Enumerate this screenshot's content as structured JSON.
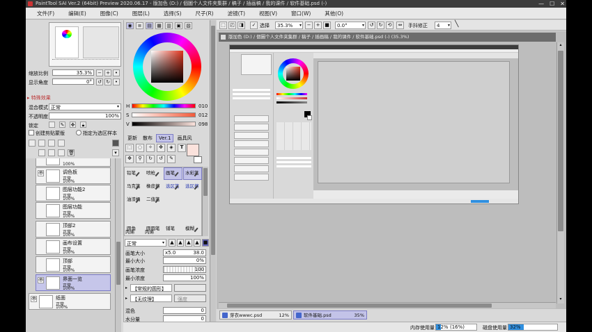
{
  "window": {
    "title": "PaintTool SAI Ver.2 (64bit) Preview 2020.06.17 - 版加色 (D:) / 個圖个人文件夹集群 / 稿子 / 插画稿 / 我的课件 / 软件基础.psd (-)",
    "buttons": [
      "—",
      "☐",
      "✕"
    ]
  },
  "menu": [
    "文件(F)",
    "编辑(E)",
    "图像(C)",
    "图层(L)",
    "选择(S)",
    "尺子(R)",
    "滤镜(T)",
    "视图(V)",
    "窗口(W)",
    "其他(O)"
  ],
  "navigator": {
    "zoom_label": "缩放比例",
    "zoom_value": "35.3%",
    "angle_label": "显示角度",
    "angle_value": "0°"
  },
  "layer_props": {
    "effects_header": "▸ 特殊效果",
    "blend_label": "混合模式",
    "blend_value": "正常",
    "opacity_label": "不透明度",
    "opacity_value": "100%",
    "lock_label": "锁定",
    "clip_label": "创建剪贴蒙版",
    "select_src_label": "指定为选区样本"
  },
  "layers": [
    {
      "name": "",
      "mode": "",
      "opacity": "100%"
    },
    {
      "name": "调色板",
      "mode": "正常",
      "opacity": "100%"
    },
    {
      "name": "图层功能2",
      "mode": "正常",
      "opacity": "100%"
    },
    {
      "name": "图层功能",
      "mode": "正常",
      "opacity": "100%"
    },
    {
      "name": "顶部2",
      "mode": "正常",
      "opacity": "100%"
    },
    {
      "name": "画布设置",
      "mode": "正常",
      "opacity": "100%"
    },
    {
      "name": "顶部",
      "mode": "正常",
      "opacity": "100%"
    },
    {
      "name": "界面一览",
      "mode": "正常",
      "opacity": "100%"
    },
    {
      "name": "纸面",
      "mode": "正常",
      "opacity": "100%"
    }
  ],
  "color": {
    "h_label": "H",
    "h_value": "010",
    "s_label": "S",
    "s_value": "012",
    "v_label": "V",
    "v_value": "098",
    "main_color": "#fbe2dc",
    "sub_color": "#ffffff"
  },
  "tool_tabs": [
    "更新",
    "散布",
    "Ver.1",
    "画具风"
  ],
  "tools": [
    {
      "label": "铅笔",
      "selected": false
    },
    {
      "label": "喷枪",
      "selected": false
    },
    {
      "label": "画笔",
      "selected": true
    },
    {
      "label": "水彩笔",
      "selected": true
    },
    {
      "label": "马克笔",
      "selected": false
    },
    {
      "label": "橡皮擦",
      "selected": false
    },
    {
      "label": "选区笔",
      "selected": false
    },
    {
      "label": "选区擦",
      "selected": false
    },
    {
      "label": "油漆桶",
      "selected": false
    },
    {
      "label": "二值笔",
      "selected": false
    },
    {
      "label": "",
      "selected": false
    },
    {
      "label": "",
      "selected": false
    },
    {
      "label": "",
      "selected": false
    },
    {
      "label": "",
      "selected": false
    },
    {
      "label": "",
      "selected": false
    },
    {
      "label": "",
      "selected": false
    },
    {
      "label": "圆角",
      "selected": false
    },
    {
      "label": "圆圆笔",
      "selected": false
    },
    {
      "label": "铺笔",
      "selected": false
    },
    {
      "label": "模糊",
      "selected": false
    },
    {
      "label": "丙烯",
      "selected": false
    },
    {
      "label": "丙烯",
      "selected": false
    },
    {
      "label": "",
      "selected": false
    },
    {
      "label": "",
      "selected": false
    }
  ],
  "brush": {
    "mode_value": "正常",
    "size_label": "画笔大小",
    "size_mult": "x5.0",
    "size_value": "38.0",
    "min_size_label": "最小大小",
    "min_size_value": "0%",
    "density_label": "画笔浓度",
    "density_value": "100",
    "min_density_label": "最小浓度",
    "min_density_value": "100%",
    "shape_label": "【常规的圆形】",
    "texture_label": "【无纹理】",
    "texture_strength": "强度",
    "blend_label": "混色",
    "blend_value": "0",
    "water_label": "水分量",
    "water_value": "0"
  },
  "toolbar": {
    "select_label": "选择",
    "zoom_value": "35.3%",
    "angle_value": "0.0°",
    "stabilizer_label": "手抖修正",
    "stabilizer_value": "4"
  },
  "canvas": {
    "tab_title": "版加色 (D:) / 個圖个人文件夹集群 / 稿子 / 插画稿 / 我的课件 / 软件基础.psd (-) (35.3%)"
  },
  "documents": [
    {
      "name": "芽衣wwwc.psd",
      "zoom": "12%",
      "selected": false
    },
    {
      "name": "软件基础.psd",
      "zoom": "35%",
      "selected": true
    }
  ],
  "status": {
    "mem_label": "内存使用量",
    "mem_pct": "12%",
    "mem_detail": "(16%)",
    "disk_label": "磁盘使用量",
    "disk_pct": "32%",
    "mem_fill": 0.12,
    "disk_fill": 0.32,
    "accent": "#2f8fe0"
  }
}
